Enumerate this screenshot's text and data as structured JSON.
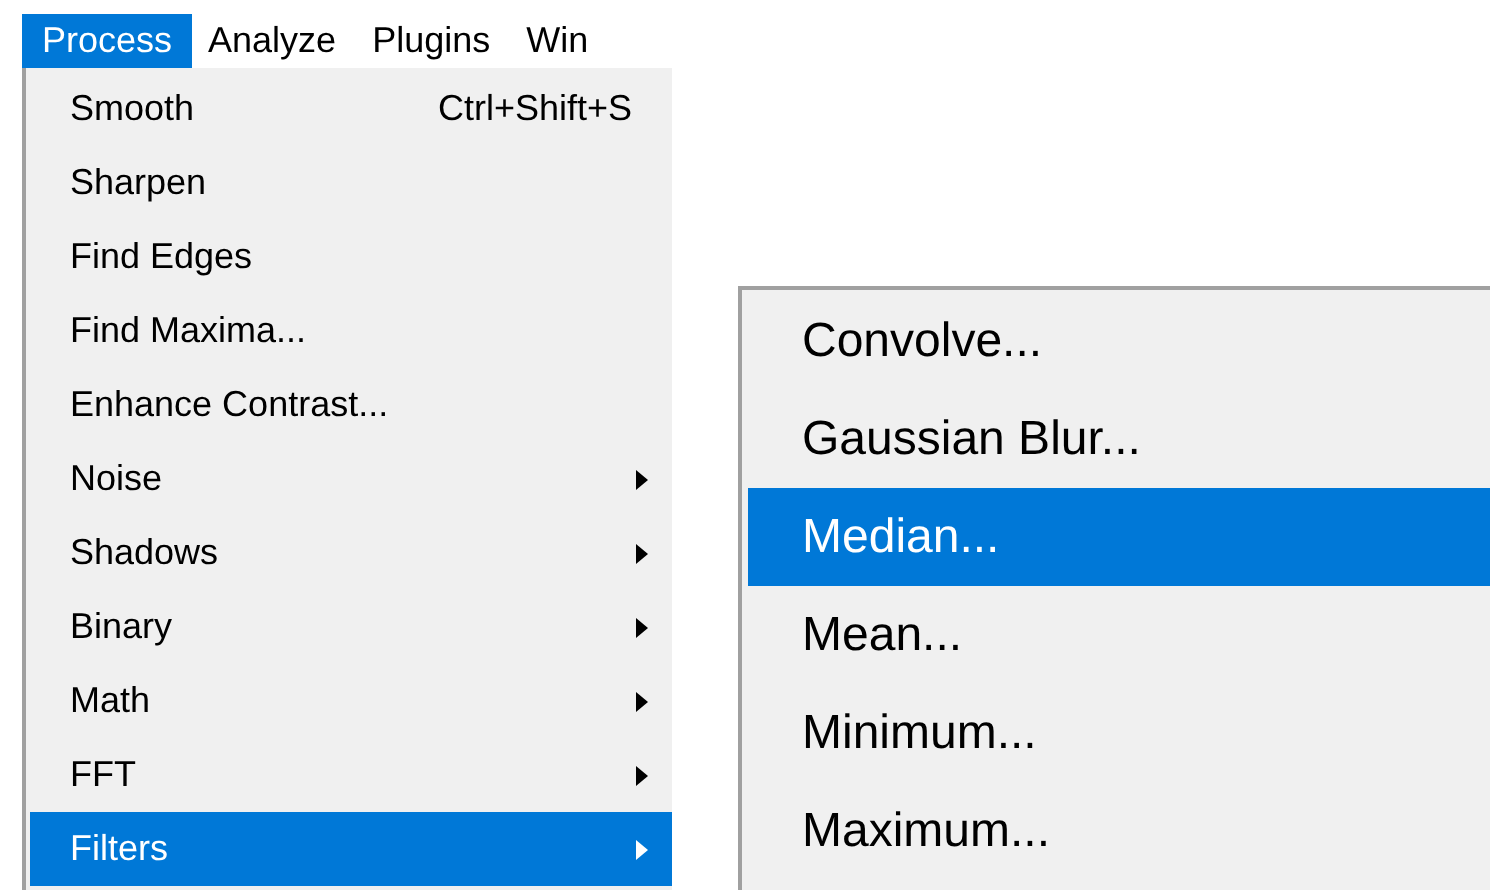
{
  "menu_bar": [
    {
      "label": "Process",
      "selected": true
    },
    {
      "label": "Analyze",
      "selected": false
    },
    {
      "label": "Plugins",
      "selected": false
    },
    {
      "label": "Win",
      "selected": false
    }
  ],
  "process_menu": [
    {
      "label": "Smooth",
      "shortcut": "Ctrl+Shift+S",
      "submenu": false,
      "selected": false
    },
    {
      "label": "Sharpen",
      "submenu": false,
      "selected": false
    },
    {
      "label": "Find Edges",
      "submenu": false,
      "selected": false
    },
    {
      "label": "Find Maxima...",
      "submenu": false,
      "selected": false
    },
    {
      "label": "Enhance Contrast...",
      "submenu": false,
      "selected": false
    },
    {
      "label": "Noise",
      "submenu": true,
      "selected": false
    },
    {
      "label": "Shadows",
      "submenu": true,
      "selected": false
    },
    {
      "label": "Binary",
      "submenu": true,
      "selected": false
    },
    {
      "label": "Math",
      "submenu": true,
      "selected": false
    },
    {
      "label": "FFT",
      "submenu": true,
      "selected": false
    },
    {
      "label": "Filters",
      "submenu": true,
      "selected": true
    }
  ],
  "filters_menu": [
    {
      "label": "Convolve...",
      "selected": false
    },
    {
      "label": "Gaussian Blur...",
      "selected": false
    },
    {
      "label": "Median...",
      "selected": true
    },
    {
      "label": "Mean...",
      "selected": false
    },
    {
      "label": "Minimum...",
      "selected": false
    },
    {
      "label": "Maximum...",
      "selected": false
    }
  ]
}
